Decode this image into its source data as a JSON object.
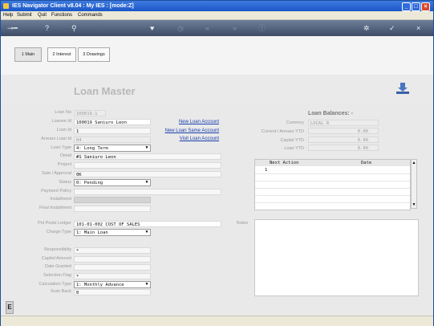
{
  "window": {
    "title": "IES Navigator Client v8.04 : My IES :        [mode:Z]",
    "controls": {
      "minimize": "_",
      "maximize": "□",
      "close": "×"
    }
  },
  "menu": {
    "items": [
      "Help",
      "Submit",
      "Quit",
      "Functions",
      "Commands"
    ]
  },
  "toolbar": {
    "icons": [
      "key-icon",
      "help-icon",
      "search-icon",
      "heart-icon",
      "clock-icon",
      "rewind-icon",
      "fast-forward-icon",
      "info-icon",
      "gear-icon",
      "check-icon",
      "close-icon"
    ]
  },
  "tabs": [
    {
      "label": "1 Main"
    },
    {
      "label": "2 Interest"
    },
    {
      "label": "3 Drawings"
    }
  ],
  "page": {
    "title": "Loan Master"
  },
  "fields": {
    "loan_no": {
      "label": "Loan No",
      "value": "100019-1"
    },
    "loanee_id": {
      "label": "Loanee Id",
      "value": "100019 Saniuro Leon"
    },
    "loan_id": {
      "label": "Loan Id",
      "value": "1"
    },
    "arrears_loan_id": {
      "label": "Arrears Loan Id",
      "value": "04"
    },
    "loan_type": {
      "label": "Loan Type",
      "value": "4: Long Term"
    },
    "detail": {
      "label": "Detail",
      "value": "#1 Saniuro Leon"
    },
    "project": {
      "label": "Project",
      "value": ""
    },
    "sale_approval": {
      "label": "Sale / Approval",
      "value": "0K"
    },
    "status": {
      "label": "Status",
      "value": "0: Pending"
    },
    "payment_policy": {
      "label": "Payment Policy",
      "value": ""
    },
    "installment": {
      "label": "Installment",
      "value": ""
    },
    "final_installment": {
      "label": "Final Installment",
      "value": ""
    },
    "pnl_posts_ledger": {
      "label": "Pnl Posts Ledger",
      "value": "101-01-002 COST OF SALES"
    },
    "charge_type": {
      "label": "Charge Type",
      "value": "1: Main Loan"
    },
    "responsibility": {
      "label": "Responsibility",
      "value": "*"
    },
    "capital_amount": {
      "label": "Capital Amount",
      "value": ""
    },
    "date_granted": {
      "label": "Date Granted",
      "value": ""
    },
    "selection_flag": {
      "label": "Selection Flag",
      "value": "*"
    },
    "calculation_type": {
      "label": "Calculation Type",
      "value": "1: Monthly Advance"
    },
    "scan_back": {
      "label": "Scan Back",
      "value": "0"
    }
  },
  "links": {
    "new_loan_account": "New Loan Account",
    "new_loan_same_account": "New Loan Same Account",
    "visit_loan_account": "Visit Loan Account"
  },
  "balances": {
    "heading": "Loan Balances: -",
    "currency": {
      "label": "Currency",
      "value": "LOCAL R"
    },
    "current_arrears_ytd": {
      "label": "Current / Arrears YTD",
      "value": "0.00"
    },
    "capital_ytd": {
      "label": "Capital YTD",
      "value": "0.00"
    },
    "loan_ytd": {
      "label": "Loan YTD",
      "value": "0.00"
    }
  },
  "actions_grid": {
    "columns": [
      "Next Action",
      "Date"
    ],
    "rows": [
      {
        "no": "1",
        "next_action": "",
        "date": ""
      }
    ]
  },
  "notes": {
    "label": "Notes",
    "value": ""
  },
  "side_badge": "E"
}
